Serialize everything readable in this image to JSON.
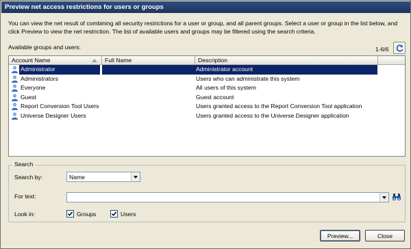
{
  "window": {
    "title": "Preview net access restrictions for users or groups"
  },
  "intro_text": "You can view the net result of combining all security restrictions for a user or group, and all parent groups. Select a user or group in the list below, and click Preview to view the net restriction. The list of available users and groups may be filtered using the search criteria.",
  "list": {
    "label": "Available groups and users:",
    "count": "1-6/6",
    "refresh_icon": "refresh-icon",
    "columns": [
      "Account Name",
      "Full Name",
      "Description"
    ],
    "rows": [
      {
        "name": "Administrator",
        "full_name": "",
        "description": "Administrator account",
        "selected": true
      },
      {
        "name": "Administrators",
        "full_name": "",
        "description": "Users who can administrate this system",
        "selected": false
      },
      {
        "name": "Everyone",
        "full_name": "",
        "description": "All users of this system",
        "selected": false
      },
      {
        "name": "Guest",
        "full_name": "",
        "description": "Guest account",
        "selected": false
      },
      {
        "name": "Report Conversion Tool Users",
        "full_name": "",
        "description": "Users granted access to the Report Conversion Tool application",
        "selected": false
      },
      {
        "name": "Universe Designer Users",
        "full_name": "",
        "description": "Users granted access to the Universe Designer application",
        "selected": false
      }
    ],
    "row_icon": "user-icon"
  },
  "search": {
    "legend": "Search",
    "search_by_label": "Search by:",
    "search_by_value": "Name",
    "for_text_label": "For text:",
    "for_text_value": "",
    "look_in_label": "Look in:",
    "groups_label": "Groups",
    "groups_checked": true,
    "users_label": "Users",
    "users_checked": true
  },
  "buttons": {
    "preview": "Preview...",
    "close": "Close"
  },
  "colors": {
    "title_bar": "#1c3560",
    "selection": "#0a246a",
    "dialog_bg": "#ece9d8"
  }
}
